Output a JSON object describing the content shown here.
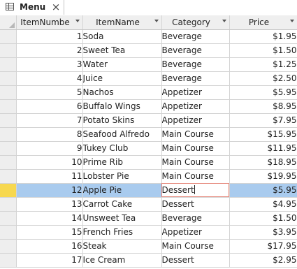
{
  "tab": {
    "title": "Menu",
    "icon": "table-icon",
    "close": "×"
  },
  "columns": [
    {
      "label": "ItemNumbe"
    },
    {
      "label": "ItemName"
    },
    {
      "label": "Category"
    },
    {
      "label": "Price"
    }
  ],
  "rows": [
    {
      "number": "1",
      "name": "Soda",
      "category": "Beverage",
      "price": "$1.95"
    },
    {
      "number": "2",
      "name": "Sweet Tea",
      "category": "Beverage",
      "price": "$1.50"
    },
    {
      "number": "3",
      "name": "Water",
      "category": "Beverage",
      "price": "$1.25"
    },
    {
      "number": "4",
      "name": "Juice",
      "category": "Beverage",
      "price": "$2.50"
    },
    {
      "number": "5",
      "name": "Nachos",
      "category": "Appetizer",
      "price": "$5.95"
    },
    {
      "number": "6",
      "name": "Buffalo Wings",
      "category": "Appetizer",
      "price": "$8.95"
    },
    {
      "number": "7",
      "name": "Potato Skins",
      "category": "Appetizer",
      "price": "$7.95"
    },
    {
      "number": "8",
      "name": "Seafood Alfredo",
      "category": "Main Course",
      "price": "$15.95"
    },
    {
      "number": "9",
      "name": "Tukey Club",
      "category": "Main Course",
      "price": "$11.95"
    },
    {
      "number": "10",
      "name": "Prime Rib",
      "category": "Main Course",
      "price": "$18.95"
    },
    {
      "number": "11",
      "name": "Lobster Pie",
      "category": "Main Course",
      "price": "$19.95"
    },
    {
      "number": "12",
      "name": "Apple Pie",
      "category": "Dessert",
      "price": "$5.95"
    },
    {
      "number": "13",
      "name": "Carrot Cake",
      "category": "Dessert",
      "price": "$4.95"
    },
    {
      "number": "14",
      "name": "Unsweet Tea",
      "category": "Beverage",
      "price": "$1.50"
    },
    {
      "number": "15",
      "name": "French Fries",
      "category": "Appetizer",
      "price": "$3.95"
    },
    {
      "number": "16",
      "name": "Steak",
      "category": "Main Course",
      "price": "$17.95"
    },
    {
      "number": "17",
      "name": "Ice Cream",
      "category": "Dessert",
      "price": "$2.95"
    }
  ],
  "current_row": 11,
  "colors": {
    "selected_row": "#a9cbee",
    "sorted_header": "#f6e07a",
    "record_selector_active": "#f7d84f"
  }
}
